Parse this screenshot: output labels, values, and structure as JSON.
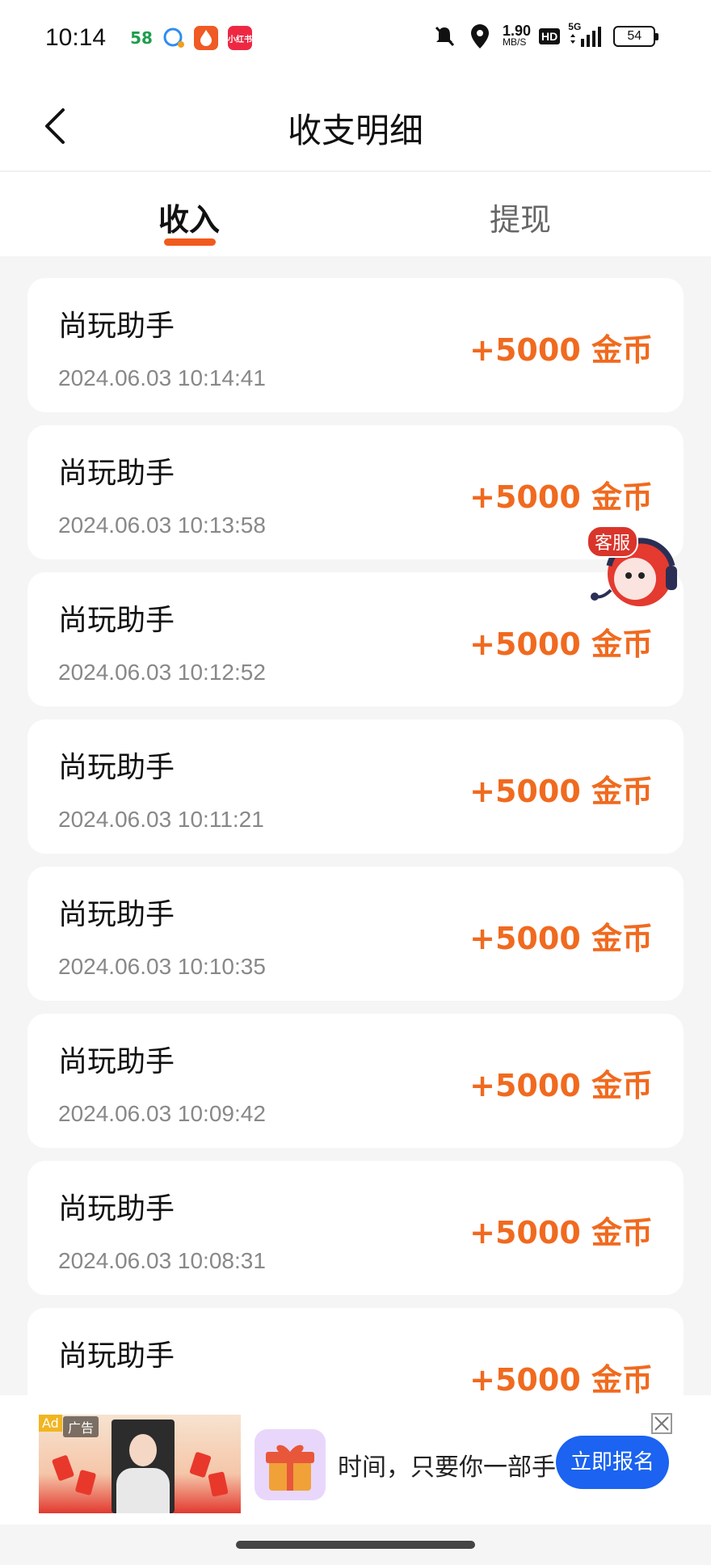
{
  "status_bar": {
    "time": "10:14",
    "app_icons": [
      "58",
      "小红书"
    ],
    "net_speed": "1.90",
    "net_unit": "MB/S",
    "hd_label": "HD",
    "signal_label": "5G",
    "battery": "54"
  },
  "nav": {
    "title": "收支明细"
  },
  "tabs": [
    {
      "label": "收入",
      "active": true
    },
    {
      "label": "提现",
      "active": false
    }
  ],
  "records": [
    {
      "name": "尚玩助手",
      "time": "2024.06.03 10:14:41",
      "amount": "+5000 金币"
    },
    {
      "name": "尚玩助手",
      "time": "2024.06.03 10:13:58",
      "amount": "+5000 金币"
    },
    {
      "name": "尚玩助手",
      "time": "2024.06.03 10:12:52",
      "amount": "+5000 金币"
    },
    {
      "name": "尚玩助手",
      "time": "2024.06.03 10:11:21",
      "amount": "+5000 金币"
    },
    {
      "name": "尚玩助手",
      "time": "2024.06.03 10:10:35",
      "amount": "+5000 金币"
    },
    {
      "name": "尚玩助手",
      "time": "2024.06.03 10:09:42",
      "amount": "+5000 金币"
    },
    {
      "name": "尚玩助手",
      "time": "2024.06.03 10:08:31",
      "amount": "+5000 金币"
    },
    {
      "name": "尚玩助手",
      "time": "",
      "amount": "+5000 金币"
    }
  ],
  "service": {
    "label": "客服"
  },
  "ad": {
    "badge": "Ad",
    "label": "广告",
    "text": "时间，只要你一部手",
    "cta": "立即报名"
  },
  "colors": {
    "accent": "#f25a1c",
    "amount": "#f06a1f",
    "cta": "#1b63f0"
  }
}
